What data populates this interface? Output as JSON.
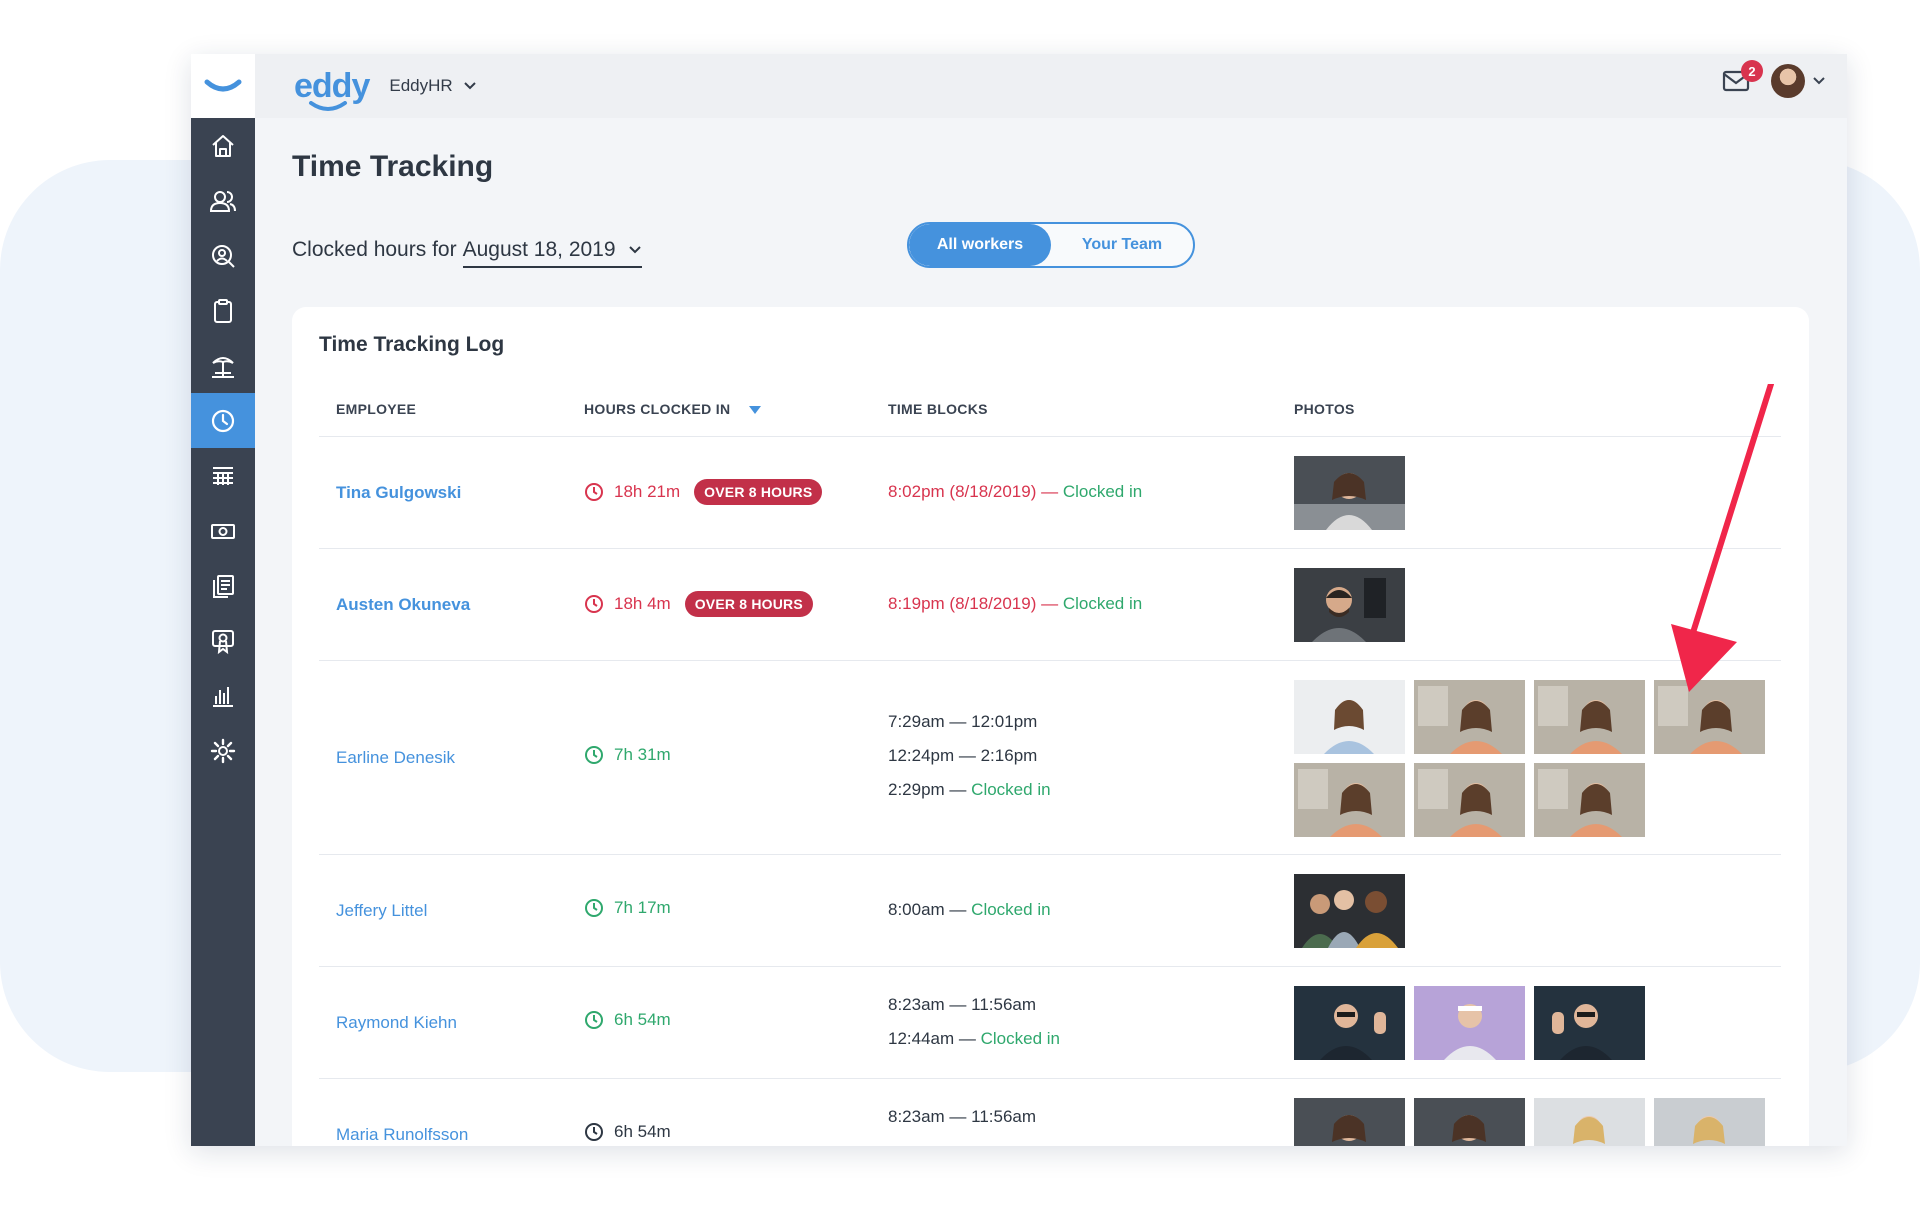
{
  "app": {
    "brand": "eddy",
    "org": "EddyHR",
    "mail_count": "2"
  },
  "page": {
    "title": "Time Tracking",
    "clocked_label": "Clocked hours for",
    "date": "August 18, 2019",
    "toggle": {
      "all": "All workers",
      "team": "Your Team"
    }
  },
  "log": {
    "title": "Time Tracking Log",
    "columns": {
      "employee": "EMPLOYEE",
      "hours": "HOURS CLOCKED IN",
      "blocks": "TIME BLOCKS",
      "photos": "PHOTOS"
    },
    "rows": [
      {
        "name": "Tina Gulgowski",
        "hours": "18h 21m",
        "badge": "OVER 8 HOURS",
        "blocks": [
          {
            "time": "8:02pm (8/18/2019) —",
            "status": "Clocked in"
          }
        ]
      },
      {
        "name": "Austen Okuneva",
        "hours": "18h 4m",
        "badge": "OVER 8 HOURS",
        "blocks": [
          {
            "time": "8:19pm  (8/18/2019) —",
            "status": "Clocked in"
          }
        ]
      },
      {
        "name": "Earline Denesik",
        "hours": "7h 31m",
        "blocks": [
          {
            "time": "7:29am — 12:01pm"
          },
          {
            "time": "12:24pm — 2:16pm"
          },
          {
            "time": "2:29pm —",
            "status": "Clocked in"
          }
        ]
      },
      {
        "name": "Jeffery Littel",
        "hours": "7h 17m",
        "blocks": [
          {
            "time": "8:00am —",
            "status": "Clocked in"
          }
        ]
      },
      {
        "name": "Raymond Kiehn",
        "hours": "6h 54m",
        "blocks": [
          {
            "time": "8:23am — 11:56am"
          },
          {
            "time": "12:44am —",
            "status": "Clocked in"
          }
        ]
      },
      {
        "name": "Maria Runolfsson",
        "hours": "6h 54m",
        "blocks": [
          {
            "time": "8:23am — 11:56am"
          }
        ]
      }
    ]
  },
  "colors": {
    "accent": "#4592dd",
    "sidebar": "#3a4351",
    "over": "#c23049",
    "ok": "#2fa86d",
    "annotation": "#f0264a"
  },
  "icons": [
    "home-icon",
    "people-icon",
    "user-search-icon",
    "clipboard-icon",
    "beach-icon",
    "clock-icon",
    "grid-icon",
    "money-icon",
    "documents-icon",
    "certificate-icon",
    "bar-chart-icon",
    "gear-icon",
    "mail-icon",
    "chevron-down-icon",
    "sort-down-icon"
  ]
}
